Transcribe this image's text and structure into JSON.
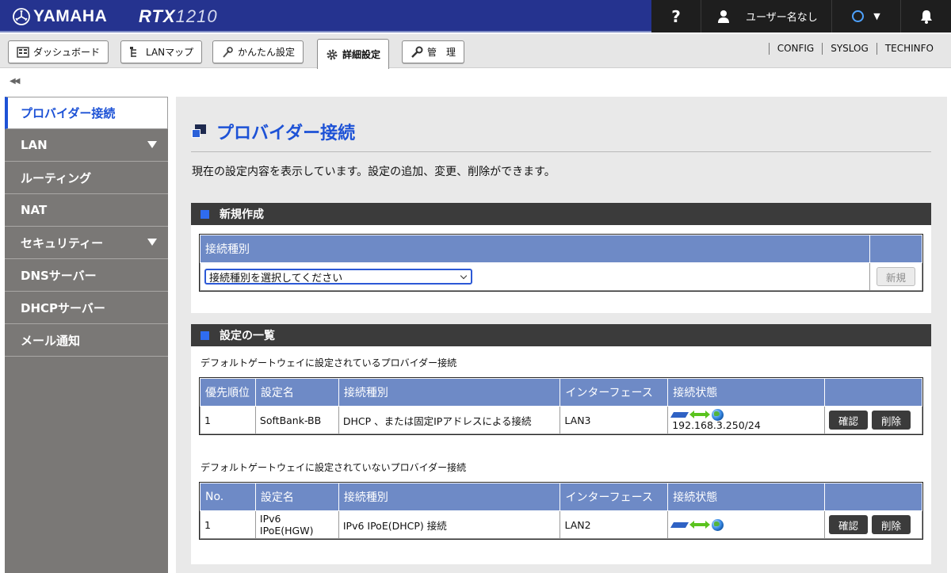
{
  "header": {
    "brand": "YAMAHA",
    "product_prefix": "RTX",
    "product_number": "1210",
    "help_label": "?",
    "user_label": "ユーザー名なし",
    "status_caret": "▼"
  },
  "tabs": [
    {
      "label": "ダッシュボード",
      "icon": "dashboard-icon"
    },
    {
      "label": "LANマップ",
      "icon": "lanmap-icon"
    },
    {
      "label": "かんたん設定",
      "icon": "wand-icon"
    },
    {
      "label": "詳細設定",
      "icon": "gear-icon",
      "active": true
    },
    {
      "label": "管　理",
      "icon": "wrench-icon"
    }
  ],
  "toplinks": [
    "CONFIG",
    "SYSLOG",
    "TECHINFO"
  ],
  "collapse_symbol": "◀◀",
  "sidebar": {
    "items": [
      {
        "label": "プロバイダー接続",
        "active": true
      },
      {
        "label": "LAN",
        "expandable": true
      },
      {
        "label": "ルーティング"
      },
      {
        "label": "NAT"
      },
      {
        "label": "セキュリティー",
        "expandable": true
      },
      {
        "label": "DNSサーバー"
      },
      {
        "label": "DHCPサーバー"
      },
      {
        "label": "メール通知"
      }
    ]
  },
  "page": {
    "title": "プロバイダー接続",
    "description": "現在の設定内容を表示しています。設定の追加、変更、削除ができます。"
  },
  "new_section": {
    "heading": "新規作成",
    "column_header": "接続種別",
    "select_value": "接続種別を選択してください",
    "new_button": "新規"
  },
  "list_section": {
    "heading": "設定の一覧",
    "default_title": "デフォルトゲートウェイに設定されているプロバイダー接続",
    "default_headers": [
      "優先順位",
      "設定名",
      "接続種別",
      "インターフェース",
      "接続状態"
    ],
    "default_rows": [
      {
        "col1": "1",
        "name": "SoftBank-BB",
        "type": "DHCP 、または固定IPアドレスによる接続",
        "iface": "LAN3",
        "address": "192.168.3.250/24"
      }
    ],
    "nondefault_title": "デフォルトゲートウェイに設定されていないプロバイダー接続",
    "nondefault_headers": [
      "No.",
      "設定名",
      "接続種別",
      "インターフェース",
      "接続状態"
    ],
    "nondefault_rows": [
      {
        "col1": "1",
        "name": "IPv6 IPoE(HGW)",
        "type": "IPv6 IPoE(DHCP) 接続",
        "iface": "LAN2",
        "address": ""
      }
    ],
    "confirm_button": "確認",
    "delete_button": "削除"
  },
  "colors": {
    "topbar": "#25338f",
    "accent": "#1d52d6",
    "table_header": "#6e8ac6",
    "sidebar": "#7a7876"
  }
}
